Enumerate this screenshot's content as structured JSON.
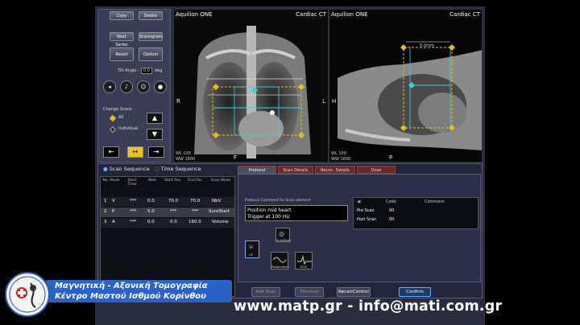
{
  "left_panel": {
    "top_buttons": [
      "Copy",
      "Delete",
      "Next Series",
      "Scanogram"
    ],
    "reset_label": "Reset",
    "option_label": "Option",
    "tilt_label": "Tilt Angle :",
    "tilt_value": "0.0",
    "tilt_unit": "deg",
    "group_title": "Change Scans",
    "radio_all": "All",
    "radio_individual": "Individual"
  },
  "viewport_left": {
    "title": "Aquilion ONE",
    "protocol": "Cardiac CT",
    "left_orient": "R",
    "right_orient": "L",
    "bottom_orient": "F",
    "wl": "WL  100",
    "ww": "WW  1800"
  },
  "viewport_right": {
    "title": "Aquilion ONE",
    "protocol": "Cardiac CT",
    "left_orient": "H",
    "bottom_orient": "P",
    "fov_label": "0.0mm",
    "wl": "WL  100",
    "ww": "WW  1800"
  },
  "sequence": {
    "tab_scan": "Scan Sequence",
    "tab_time": "Time Sequence",
    "headers": [
      "No. Mode",
      "Start Time",
      "Wait",
      "Start Pos",
      "End Pos",
      "Scan Mode"
    ],
    "rows": [
      {
        "no": "1",
        "mode": "V",
        "time": "***",
        "wait": "0.0",
        "start": "70.0",
        "end": "70.0",
        "scan": "NbV"
      },
      {
        "no": "2",
        "mode": "P",
        "time": "***",
        "wait": "5.0",
        "start": "***",
        "end": "***",
        "scan": "SureStart"
      },
      {
        "no": "3",
        "mode": "A",
        "time": "***",
        "wait": "0.0",
        "start": "0.0",
        "end": "160.0",
        "scan": "Volume"
      }
    ]
  },
  "details_tabs": [
    "Protocol",
    "Scan Details",
    "Recon. Details",
    "Dose"
  ],
  "protocol": {
    "comment_title": "Protocol Comment for Scan element",
    "comment_lines": [
      "Position mid heart",
      "Trigger at 100 HU"
    ],
    "voice_headers": [
      "Code",
      "Comment"
    ],
    "voice_rows": [
      {
        "label": "Pre Scan",
        "code": "00"
      },
      {
        "label": "Post Scan",
        "code": "00"
      }
    ],
    "icons": [
      "CE",
      "SureStart",
      "Respiratory",
      "ECG"
    ]
  },
  "actions": {
    "add_scan": "Add Scan",
    "previous": "Previous",
    "recalc": "RecalcControl",
    "confirm": "Confirm"
  },
  "overlay": {
    "line1": "Μαγνητική - Αξονική Τομογραφία",
    "line2": "Κέντρο Μαστού Ισθμού Κορίνθου",
    "website": "www.matp.gr - info@mati.com.gr"
  },
  "colors": {
    "confirm_border": "#6ab0ff",
    "banner_blue": "#2a62c8",
    "marker_yellow": "#e0c020",
    "roi_cyan": "#3fd0e0"
  }
}
